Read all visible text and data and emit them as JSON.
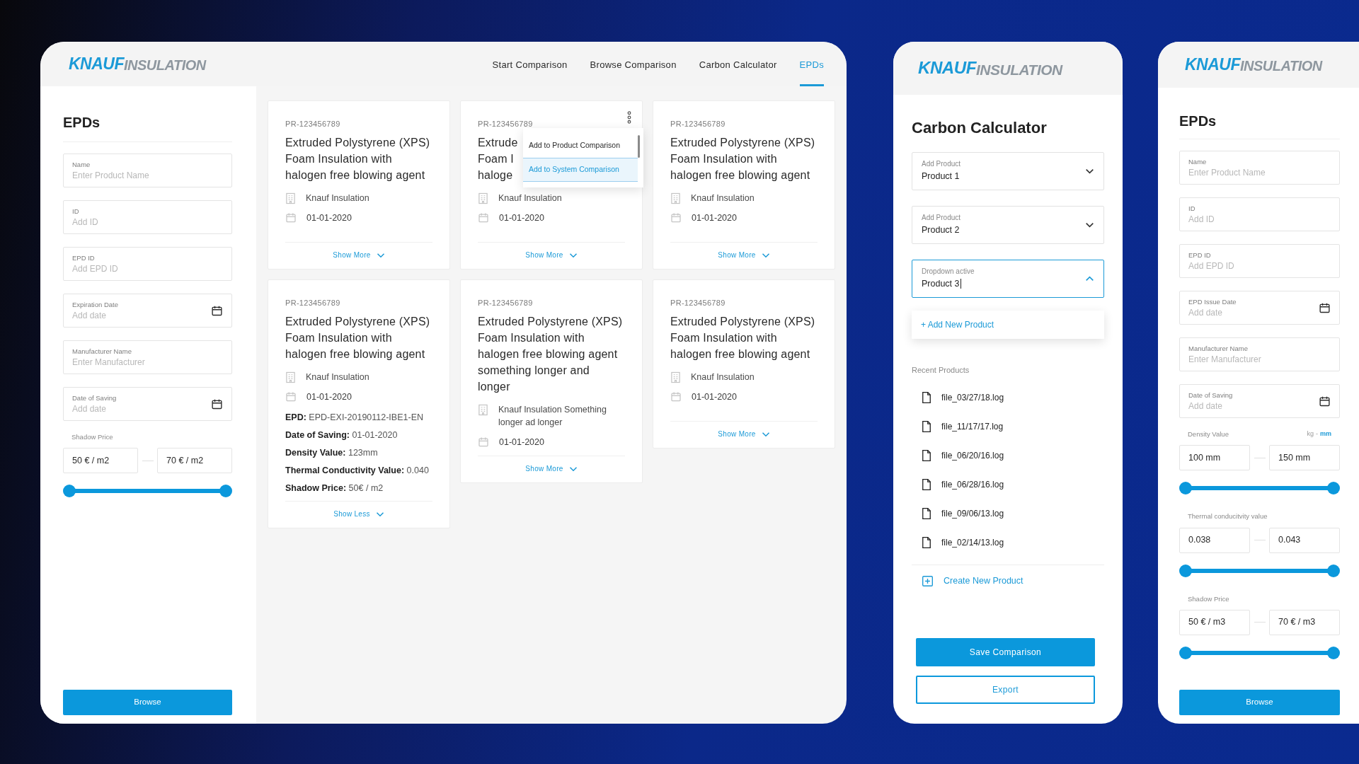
{
  "epd_browser": {
    "logo": {
      "brand": "KNAUF",
      "suffix": "INSULATION"
    },
    "nav": [
      {
        "label": "Start Comparison",
        "selected": false
      },
      {
        "label": "Browse Comparison",
        "selected": false
      },
      {
        "label": "Carbon Calculator",
        "selected": false
      },
      {
        "label": "EPDs",
        "selected": true
      }
    ],
    "sidebar": {
      "title": "EPDs",
      "fields": [
        {
          "kind": "text",
          "label": "Name",
          "placeholder": "Enter Product Name"
        },
        {
          "kind": "text",
          "label": "ID",
          "placeholder": "Add ID"
        },
        {
          "kind": "text",
          "label": "EPD ID",
          "placeholder": "Add EPD ID"
        },
        {
          "kind": "date",
          "label": "Expiration Date",
          "placeholder": "Add date"
        },
        {
          "kind": "text",
          "label": "Manufacturer Name",
          "placeholder": "Enter Manufacturer"
        },
        {
          "kind": "date",
          "label": "Date of Saving",
          "placeholder": "Add date"
        }
      ],
      "ranges": [
        {
          "label": "Shadow Price",
          "min": "50 € / m2",
          "max": "70 € / m2",
          "level": 1
        }
      ],
      "button": "Browse"
    },
    "cards": [
      {
        "id": "PR-123456789",
        "title_lines": [
          "Extruded Polystyrene (XPS)",
          "Foam Insulation with",
          "halogen free blowing agent"
        ],
        "manufacturer": "Knauf Insulation",
        "date": "01-01-2020",
        "toggle": "Show More"
      },
      {
        "id": "PR-123456789",
        "title_lines": [
          "Extrude",
          "Foam I",
          "haloge"
        ],
        "manufacturer": "Knauf Insulation",
        "date": "01-01-2020",
        "toggle": "Show More",
        "menu": [
          {
            "label": "Add to Product Comparison",
            "selected": false
          },
          {
            "label": "Add to System Comparison",
            "selected": true
          }
        ]
      },
      {
        "id": "PR-123456789",
        "title_lines": [
          "Extruded Polystyrene (XPS)",
          "Foam Insulation with",
          "halogen free blowing agent"
        ],
        "manufacturer": "Knauf Insulation",
        "date": "01-01-2020",
        "toggle": "Show More"
      },
      {
        "id": "PR-123456789",
        "title_lines": [
          "Extruded Polystyrene (XPS)",
          "Foam Insulation with",
          "halogen free blowing agent"
        ],
        "manufacturer": "Knauf Insulation",
        "date": "01-01-2020",
        "toggle": "Show Less",
        "details": [
          {
            "label": "EPD:",
            "value": "EPD-EXI-20190112-IBE1-EN"
          },
          {
            "label": "Date of Saving:",
            "value": "01-01-2020"
          },
          {
            "label": "Density Value:",
            "value": "123mm"
          },
          {
            "label": "Thermal Conductivity Value:",
            "value": "0.040"
          },
          {
            "label": "Shadow Price:",
            "value": "50€ / m2"
          }
        ]
      },
      {
        "id": "PR-123456789",
        "title_lines": [
          "Extruded Polystyrene (XPS)",
          "Foam Insulation with",
          "halogen free blowing agent",
          "something longer and",
          "longer"
        ],
        "manufacturer": "Knauf Insulation Something longer ad longer",
        "date": "01-01-2020",
        "toggle": "Show More"
      },
      {
        "id": "PR-123456789",
        "title_lines": [
          "Extruded Polystyrene (XPS)",
          "Foam Insulation with",
          "halogen free blowing agent"
        ],
        "manufacturer": "Knauf Insulation",
        "date": "01-01-2020",
        "toggle": "Show More"
      }
    ]
  },
  "carbon_calculator": {
    "logo": {
      "brand": "KNAUF",
      "suffix": "INSULATION"
    },
    "title": "Carbon Calculator",
    "dropdowns": [
      {
        "label": "Add Product",
        "value": "Product 1",
        "open": false
      },
      {
        "label": "Add Product",
        "value": "Product 2",
        "open": false
      },
      {
        "label": "Dropdown active",
        "value": "Product 3",
        "open": true,
        "menu_action": "+ Add New Product"
      }
    ],
    "recent_label": "Recent Products",
    "recent_files": [
      "file_03/27/18.log",
      "file_11/17/17.log",
      "file_06/20/16.log",
      "file_06/28/16.log",
      "file_09/06/13.log",
      "file_02/14/13.log"
    ],
    "create_action": "Create New Product",
    "buttons": [
      {
        "kind": "primary",
        "label": "Save Comparison"
      },
      {
        "kind": "outline",
        "label": "Export"
      }
    ]
  },
  "epd_mobile": {
    "logo": {
      "brand": "KNAUF",
      "suffix": "INSULATION"
    },
    "title": "EPDs",
    "fields": [
      {
        "kind": "text",
        "label": "Name",
        "placeholder": "Enter Product Name"
      },
      {
        "kind": "text",
        "label": "ID",
        "placeholder": "Add ID"
      },
      {
        "kind": "text",
        "label": "EPD ID",
        "placeholder": "Add EPD ID"
      },
      {
        "kind": "date",
        "label": "EPD Issue Date",
        "placeholder": "Add date"
      },
      {
        "kind": "text",
        "label": "Manufacturer Name",
        "placeholder": "Enter Manufacturer"
      },
      {
        "kind": "date",
        "label": "Date of Saving",
        "placeholder": "Add date"
      }
    ],
    "ranges": [
      {
        "label": "Density Value",
        "units": [
          {
            "label": "kg",
            "selected": false
          },
          {
            "label": "mm",
            "selected": true
          }
        ],
        "unit_separator": "-",
        "min": "100 mm",
        "max": "150 mm",
        "level": 1
      },
      {
        "label": "Thermal conducitvity value",
        "min": "0.038",
        "max": "0.043",
        "level": 1
      },
      {
        "label": "Shadow Price",
        "min": "50 € / m3",
        "max": "70 € / m3",
        "level": 1
      }
    ],
    "button": "Browse"
  }
}
